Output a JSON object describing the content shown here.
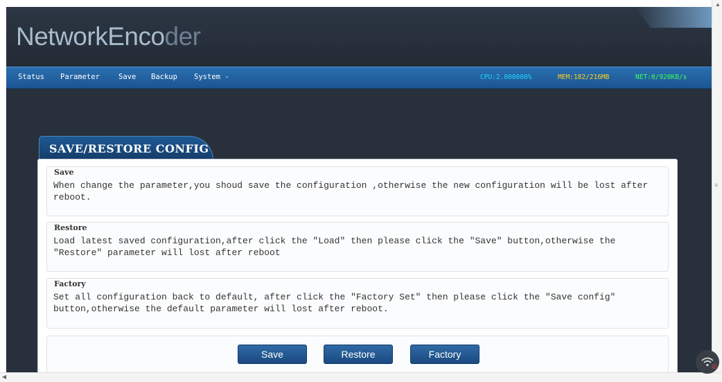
{
  "app": {
    "logo_main": "NetworkEnco",
    "logo_tail": "der"
  },
  "nav": {
    "items": [
      "Status",
      "Parameter",
      "Save",
      "Backup",
      "System -"
    ],
    "stats": {
      "cpu": "CPU:2.000000%",
      "mem": "MEM:182/216MB",
      "net": "NET:0/920KB/s"
    }
  },
  "colors": {
    "cpu": "#1fd6ff",
    "mem": "#ffd21f",
    "net": "#3cff5a",
    "accent": "#1c5591"
  },
  "panel": {
    "title": "SAVE/RESTORE CONFIG",
    "sections": [
      {
        "title": "Save",
        "text": "When change the parameter,you shoud save the configuration ,otherwise the new configuration will be lost after reboot."
      },
      {
        "title": "Restore",
        "text": "Load latest saved configuration,after click the \"Load\" then please click the \"Save\" button,otherwise the \"Restore\" parameter will lost after reboot"
      },
      {
        "title": "Factory",
        "text": "Set all configuration back to default, after click the \"Factory Set\" then please click the \"Save config\" button,otherwise the default parameter will lost after reboot."
      }
    ],
    "buttons": {
      "save": "Save",
      "restore": "Restore",
      "factory": "Factory"
    }
  },
  "icons": {
    "wifi": "wifi-off-icon"
  }
}
